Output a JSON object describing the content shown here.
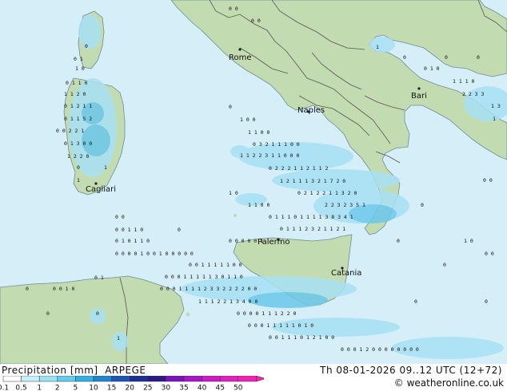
{
  "map": {
    "cities": [
      {
        "id": "rome",
        "label": "Rome"
      },
      {
        "id": "bari",
        "label": "Bari"
      },
      {
        "id": "naples",
        "label": "Naples"
      },
      {
        "id": "cagliari",
        "label": "Cagliari"
      },
      {
        "id": "palermo",
        "label": "Palermo"
      },
      {
        "id": "catania",
        "label": "Catania"
      }
    ],
    "colors": {
      "sea": "#d6eef8",
      "land": "#c3dbb0",
      "precip_light": "#a7e1f5",
      "precip_mid": "#6cc8ec",
      "border": "#555555",
      "coast": "#6e8c9a"
    }
  },
  "footer": {
    "product": "Precipitation [mm]",
    "model": "ARPEGE",
    "valid": "Th 08-01-2026 09..12 UTC (12+72)",
    "credit": "© weatheronline.co.uk"
  },
  "legend": {
    "ticks": [
      "0.1",
      "0.5",
      "1",
      "2",
      "5",
      "10",
      "15",
      "20",
      "25",
      "30",
      "35",
      "40",
      "45",
      "50"
    ],
    "colors": [
      "#ffffff",
      "#c8f0fa",
      "#9ae3f6",
      "#63cdef",
      "#31b2e6",
      "#1f86d4",
      "#1c56b8",
      "#1a2f98",
      "#2a1a86",
      "#7a12bf",
      "#a814cc",
      "#cf18c8",
      "#e21fc0",
      "#f51fb8"
    ]
  }
}
